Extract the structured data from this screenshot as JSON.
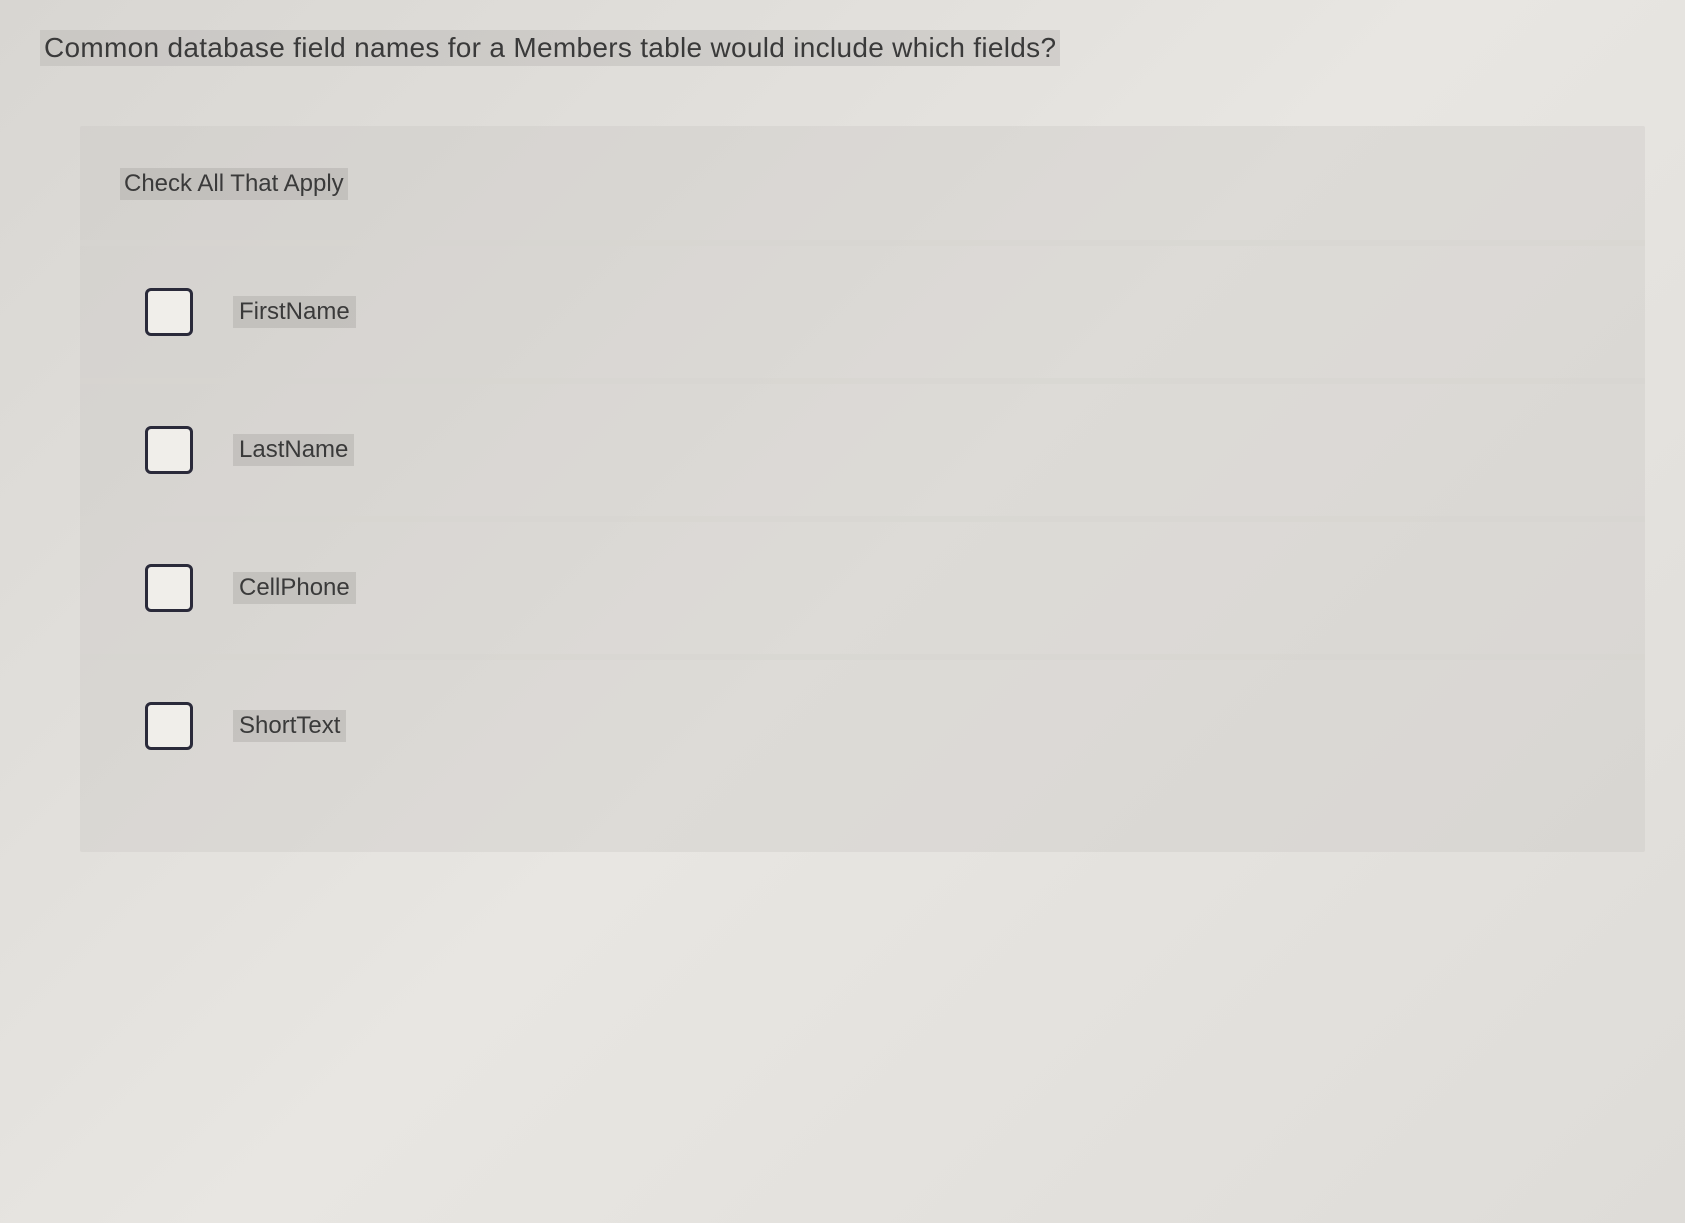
{
  "question": "Common database field names for a Members table would include which fields?",
  "instruction": "Check All That Apply",
  "options": [
    {
      "label": "FirstName",
      "checked": false
    },
    {
      "label": "LastName",
      "checked": false
    },
    {
      "label": "CellPhone",
      "checked": false
    },
    {
      "label": "ShortText",
      "checked": false
    }
  ]
}
